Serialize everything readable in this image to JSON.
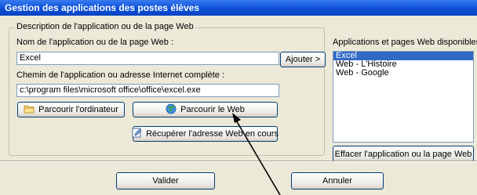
{
  "window": {
    "title": "Gestion des applications des postes élèves"
  },
  "description_group": {
    "legend": "Description de l'application ou de la page Web",
    "name_label": "Nom de l'application ou de la page Web :",
    "name_value": "Excel",
    "path_label": "Chemin de l'application ou adresse Internet complète :",
    "path_value": "c:\\program files\\microsoft office\\office\\excel.exe"
  },
  "buttons": {
    "add": "Ajouter >",
    "browse_computer": "Parcourir l'ordinateur",
    "browse_web": "Parcourir le Web",
    "get_current_address": "Récupérer l'adresse Web en cours",
    "delete": "Effacer l'application ou la page Web",
    "validate": "Valider",
    "cancel": "Annuler"
  },
  "available_list": {
    "label": "Applications et pages Web disponibles :",
    "items": [
      "Excel",
      "Web - L'Histoire",
      "Web - Google"
    ],
    "selected_index": 0
  },
  "icons": {
    "browse_computer": "folder-icon",
    "browse_web": "globe-icon",
    "get_current_address": "edit-document-icon"
  },
  "colors": {
    "title_bar": "#0a4fd6",
    "selection": "#316ac5",
    "window_bg": "#ece9d8"
  }
}
